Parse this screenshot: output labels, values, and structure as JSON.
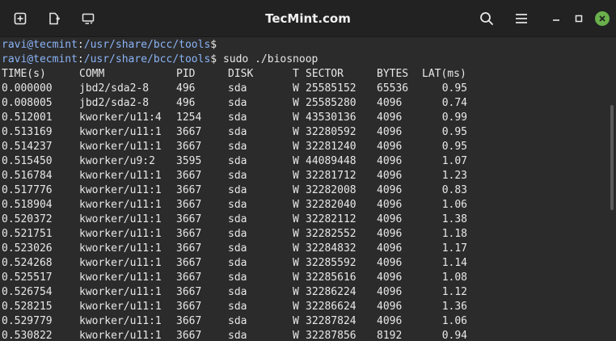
{
  "window": {
    "title": "TecMint.com",
    "accent_color": "#6ab04c"
  },
  "toolbar": {
    "new_tab_icon": "new-tab-icon",
    "split_icon": "split-terminal-icon",
    "broadcast_icon": "broadcast-icon",
    "search_icon": "search-icon",
    "menu_icon": "hamburger-menu-icon",
    "minimize_icon": "minimize-icon",
    "maximize_icon": "maximize-icon",
    "close_icon": "close-icon"
  },
  "prompts": [
    {
      "user": "ravi@tecmint",
      "sep": ":",
      "path": "/usr/share/bcc/tools",
      "symbol": "$",
      "command": ""
    },
    {
      "user": "ravi@tecmint",
      "sep": ":",
      "path": "/usr/share/bcc/tools",
      "symbol": "$",
      "command": " sudo ./biosnoop"
    }
  ],
  "table": {
    "headers": [
      "TIME(s)",
      "COMM",
      "PID",
      "DISK",
      "T",
      "SECTOR",
      "BYTES",
      "LAT(ms)"
    ],
    "rows": [
      [
        "0.000000",
        "jbd2/sda2-8",
        "496",
        "sda",
        "W",
        "25585152",
        "65536",
        "0.95"
      ],
      [
        "0.008005",
        "jbd2/sda2-8",
        "496",
        "sda",
        "W",
        "25585280",
        "4096",
        "0.74"
      ],
      [
        "0.512001",
        "kworker/u11:4",
        "1254",
        "sda",
        "W",
        "43530136",
        "4096",
        "0.99"
      ],
      [
        "0.513169",
        "kworker/u11:1",
        "3667",
        "sda",
        "W",
        "32280592",
        "4096",
        "0.95"
      ],
      [
        "0.514237",
        "kworker/u11:1",
        "3667",
        "sda",
        "W",
        "32281240",
        "4096",
        "0.95"
      ],
      [
        "0.515450",
        "kworker/u9:2",
        "3595",
        "sda",
        "W",
        "44089448",
        "4096",
        "1.07"
      ],
      [
        "0.516784",
        "kworker/u11:1",
        "3667",
        "sda",
        "W",
        "32281712",
        "4096",
        "1.23"
      ],
      [
        "0.517776",
        "kworker/u11:1",
        "3667",
        "sda",
        "W",
        "32282008",
        "4096",
        "0.83"
      ],
      [
        "0.518904",
        "kworker/u11:1",
        "3667",
        "sda",
        "W",
        "32282040",
        "4096",
        "1.06"
      ],
      [
        "0.520372",
        "kworker/u11:1",
        "3667",
        "sda",
        "W",
        "32282112",
        "4096",
        "1.38"
      ],
      [
        "0.521751",
        "kworker/u11:1",
        "3667",
        "sda",
        "W",
        "32282552",
        "4096",
        "1.18"
      ],
      [
        "0.523026",
        "kworker/u11:1",
        "3667",
        "sda",
        "W",
        "32284832",
        "4096",
        "1.17"
      ],
      [
        "0.524268",
        "kworker/u11:1",
        "3667",
        "sda",
        "W",
        "32285592",
        "4096",
        "1.14"
      ],
      [
        "0.525517",
        "kworker/u11:1",
        "3667",
        "sda",
        "W",
        "32285616",
        "4096",
        "1.08"
      ],
      [
        "0.526754",
        "kworker/u11:1",
        "3667",
        "sda",
        "W",
        "32286224",
        "4096",
        "1.12"
      ],
      [
        "0.528215",
        "kworker/u11:1",
        "3667",
        "sda",
        "W",
        "32286624",
        "4096",
        "1.36"
      ],
      [
        "0.529779",
        "kworker/u11:1",
        "3667",
        "sda",
        "W",
        "32287824",
        "4096",
        "1.06"
      ],
      [
        "0.530822",
        "kworker/u11:1",
        "3667",
        "sda",
        "W",
        "32287856",
        "8192",
        "0.94"
      ]
    ]
  }
}
